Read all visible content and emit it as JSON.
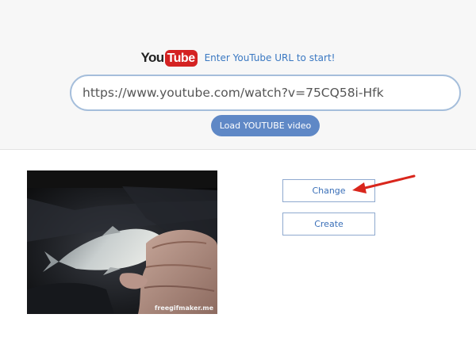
{
  "header": {
    "logo": {
      "you": "You",
      "tube": "Tube"
    },
    "hint": "Enter YouTube URL to start!"
  },
  "url_input": {
    "value": "https://www.youtube.com/watch?v=75CQ58i-Hfk",
    "placeholder": ""
  },
  "load_button": {
    "label": "Load YOUTUBE video"
  },
  "video_preview": {
    "watermark": "freegifmaker.me"
  },
  "actions": {
    "change_label": "Change",
    "create_label": "Create"
  },
  "colors": {
    "accent": "#5f88c6",
    "link": "#3a78c2",
    "youtube_red": "#d42222",
    "annotation_arrow": "#d9261c"
  }
}
